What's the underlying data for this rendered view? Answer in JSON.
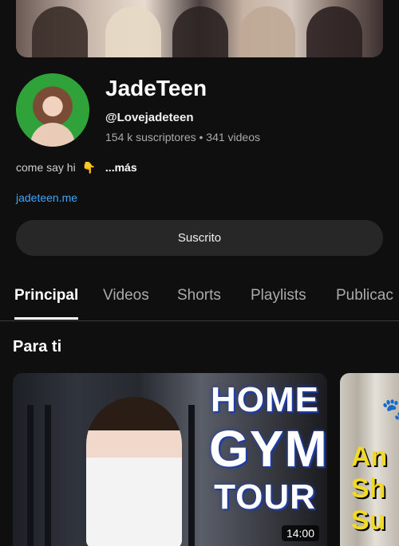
{
  "channel": {
    "title": "JadeTeen",
    "handle": "@Lovejadeteen",
    "stats": "154 k suscriptores • 341 videos",
    "about": "come say hi",
    "about_more": "...más",
    "link": "jadeteen.me",
    "subscribe_label": "Suscrito"
  },
  "tabs": [
    "Principal",
    "Videos",
    "Shorts",
    "Playlists",
    "Publicac"
  ],
  "section_title": "Para ti",
  "videos": [
    {
      "overlay": [
        "HOME",
        "GYM",
        "TOUR"
      ],
      "duration": "14:00"
    },
    {
      "overlay": [
        "An",
        "Sh",
        "Su"
      ]
    }
  ],
  "icons": {
    "emoji": "point-down-icon",
    "paw": "paw-icon"
  }
}
